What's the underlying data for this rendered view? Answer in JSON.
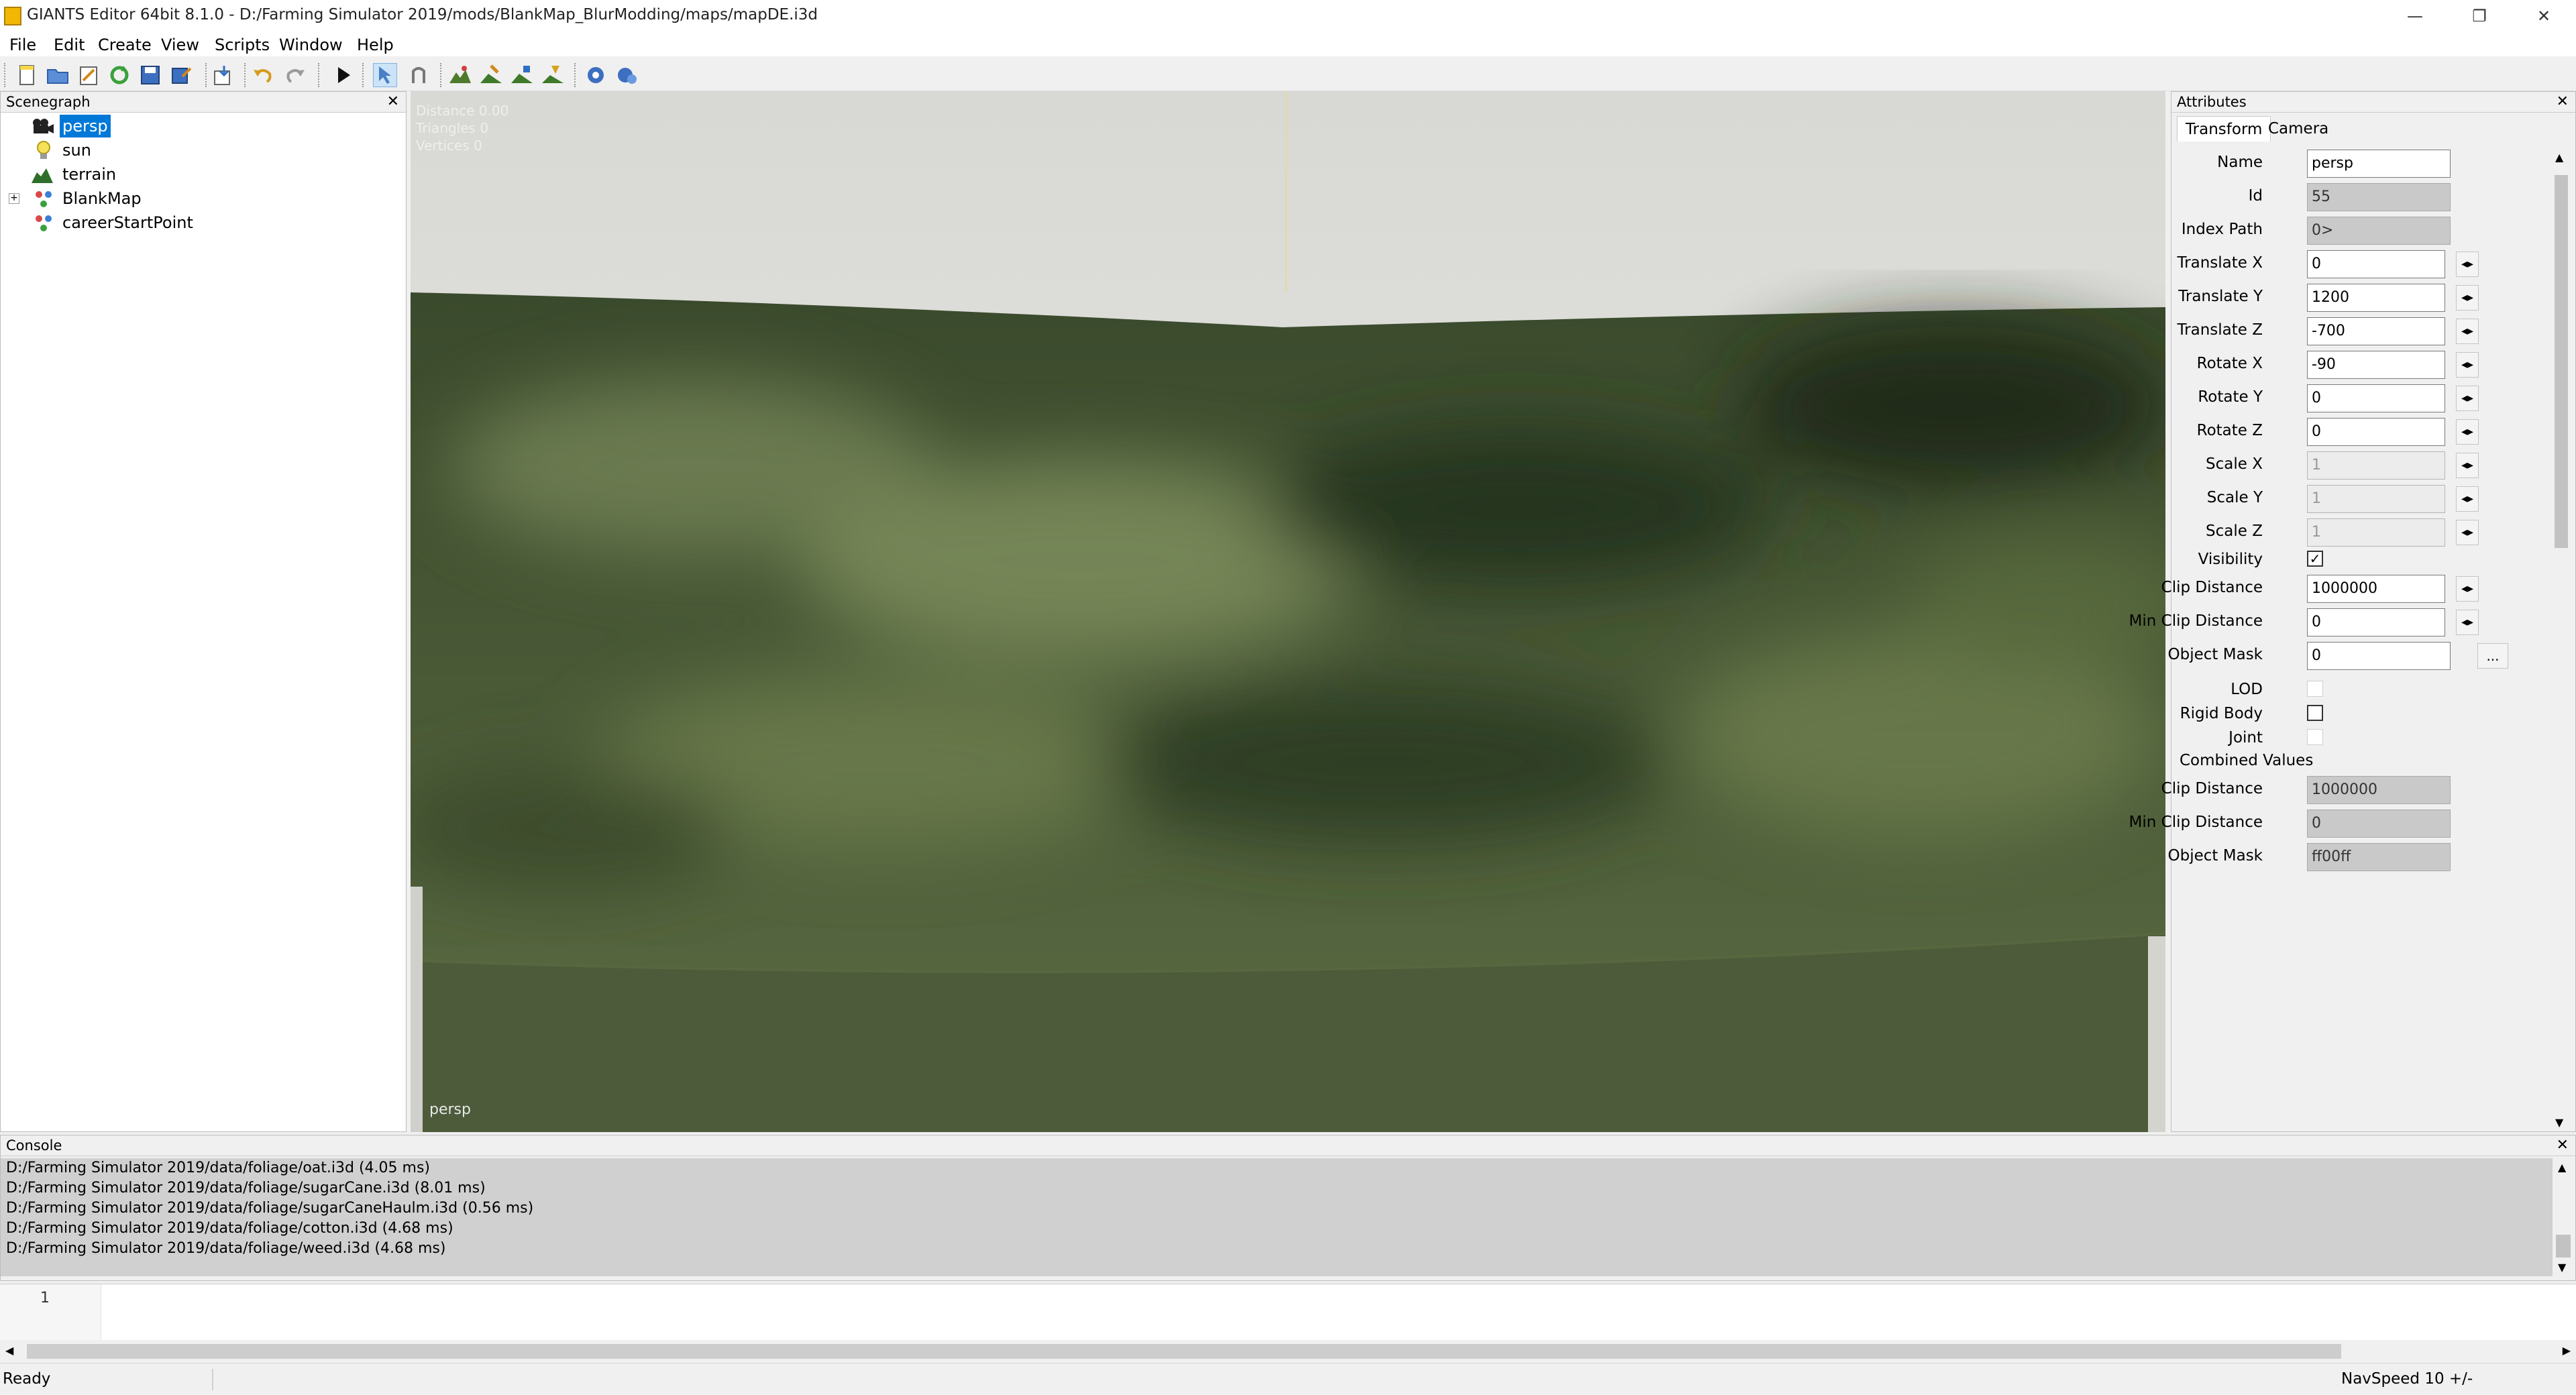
{
  "window": {
    "title": "GIANTS Editor 64bit 8.1.0 - D:/Farming Simulator 2019/mods/BlankMap_BlurModding/maps/mapDE.i3d",
    "minimize": "—",
    "restore": "❐",
    "close": "✕"
  },
  "menu": [
    "File",
    "Edit",
    "Create",
    "View",
    "Scripts",
    "Window",
    "Help"
  ],
  "scenegraph": {
    "title": "Scenegraph",
    "close": "✕",
    "nodes": [
      {
        "label": "persp",
        "icon": "camera-icon",
        "selected": true
      },
      {
        "label": "sun",
        "icon": "light-icon"
      },
      {
        "label": "terrain",
        "icon": "terrain-icon"
      },
      {
        "label": "BlankMap",
        "icon": "transform-group-icon",
        "expandable": true,
        "expander": "+"
      },
      {
        "label": "careerStartPoint",
        "icon": "transform-group-icon"
      }
    ]
  },
  "viewport": {
    "stats": [
      "Distance 0.00",
      "Triangles 0",
      "Vertices 0"
    ],
    "camera_label": "persp",
    "terrain_color": "#4d5b3a"
  },
  "attributes": {
    "title": "Attributes",
    "close": "✕",
    "tabs": [
      "Transform",
      "Camera"
    ],
    "stepper": "◂▸",
    "more": "...",
    "fields": [
      {
        "label": "Name",
        "value": "persp"
      },
      {
        "label": "Id",
        "value": "55"
      },
      {
        "label": "Index Path",
        "value": "0>"
      },
      {
        "label": "Translate X",
        "value": "0"
      },
      {
        "label": "Translate Y",
        "value": "1200"
      },
      {
        "label": "Translate Z",
        "value": "-700"
      },
      {
        "label": "Rotate X",
        "value": "-90"
      },
      {
        "label": "Rotate Y",
        "value": "0"
      },
      {
        "label": "Rotate Z",
        "value": "0"
      },
      {
        "label": "Scale X",
        "value": "1"
      },
      {
        "label": "Scale Y",
        "value": "1"
      },
      {
        "label": "Scale Z",
        "value": "1"
      }
    ],
    "visibility": {
      "label": "Visibility",
      "checked": "✓"
    },
    "clip_distance": {
      "label": "Clip Distance",
      "value": "1000000"
    },
    "min_clip_distance": {
      "label": "Min Clip Distance",
      "value": "0"
    },
    "object_mask": {
      "label": "Object Mask",
      "value": "0"
    },
    "lod": {
      "label": "LOD"
    },
    "rigid_body": {
      "label": "Rigid Body"
    },
    "joint": {
      "label": "Joint"
    },
    "combined": {
      "title": "Combined Values",
      "clip_distance": {
        "label": "Clip Distance",
        "value": "1000000"
      },
      "min_clip_distance": {
        "label": "Min Clip Distance",
        "value": "0"
      },
      "object_mask": {
        "label": "Object Mask",
        "value": "ff00ff"
      }
    }
  },
  "console": {
    "title": "Console",
    "close": "✕",
    "lines": [
      "D:/Farming Simulator 2019/data/foliage/oat.i3d (4.05 ms)",
      "D:/Farming Simulator 2019/data/foliage/sugarCane.i3d (8.01 ms)",
      "D:/Farming Simulator 2019/data/foliage/sugarCaneHaulm.i3d (0.56 ms)",
      "D:/Farming Simulator 2019/data/foliage/cotton.i3d (4.68 ms)",
      "D:/Farming Simulator 2019/data/foliage/weed.i3d (4.68 ms)"
    ],
    "editor_line": "1",
    "scroll_up": "▲",
    "scroll_down": "▼",
    "scroll_left": "◀",
    "scroll_right": "▶"
  },
  "status": {
    "left": "Ready",
    "right": "NavSpeed 10 +/-"
  },
  "toolbar_icons": [
    "new-file-icon",
    "open-folder-icon",
    "edit-icon",
    "reload-icon",
    "save-icon",
    "save-as-icon",
    "import-icon",
    "undo-icon",
    "redo-icon",
    "play-icon",
    "select-mode-icon",
    "move-mode-icon",
    "terrain-sculpt-icon",
    "terrain-paint-icon",
    "foliage-paint-icon",
    "placement-icon",
    "render-settings-icon",
    "scripts-icon"
  ]
}
